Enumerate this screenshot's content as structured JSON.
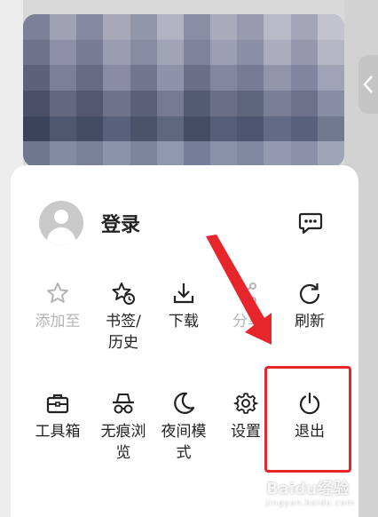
{
  "profile": {
    "login_label": "登录"
  },
  "menu_row1": [
    {
      "label": "添加至",
      "icon": "star-outline-icon",
      "disabled": true
    },
    {
      "label": "书签/历史",
      "icon": "star-clock-icon"
    },
    {
      "label": "下载",
      "icon": "download-icon"
    },
    {
      "label": "分享",
      "icon": "share-icon",
      "disabled": true
    },
    {
      "label": "刷新",
      "icon": "refresh-icon"
    }
  ],
  "menu_row2": [
    {
      "label": "工具箱",
      "icon": "toolbox-icon"
    },
    {
      "label": "无痕浏览",
      "icon": "incognito-icon"
    },
    {
      "label": "夜间模式",
      "icon": "moon-icon"
    },
    {
      "label": "设置",
      "icon": "gear-icon"
    },
    {
      "label": "退出",
      "icon": "power-icon"
    }
  ],
  "labels": {
    "add_to": "添加至",
    "bookmarks_line1": "书签/",
    "bookmarks_line2": "历史",
    "download": "下载",
    "share": "分享",
    "refresh": "刷新",
    "toolbox": "工具箱",
    "incognito_line1": "无痕浏",
    "incognito_line2": "览",
    "night_line1": "夜间模",
    "night_line2": "式",
    "settings": "设置",
    "exit": "退出"
  },
  "watermark": {
    "text": "Baidu经验",
    "sub": "jingyan.baidu.com"
  },
  "colors": {
    "annotation_red": "#e7262c",
    "text": "#222222",
    "disabled_text": "#b4b4b4"
  }
}
